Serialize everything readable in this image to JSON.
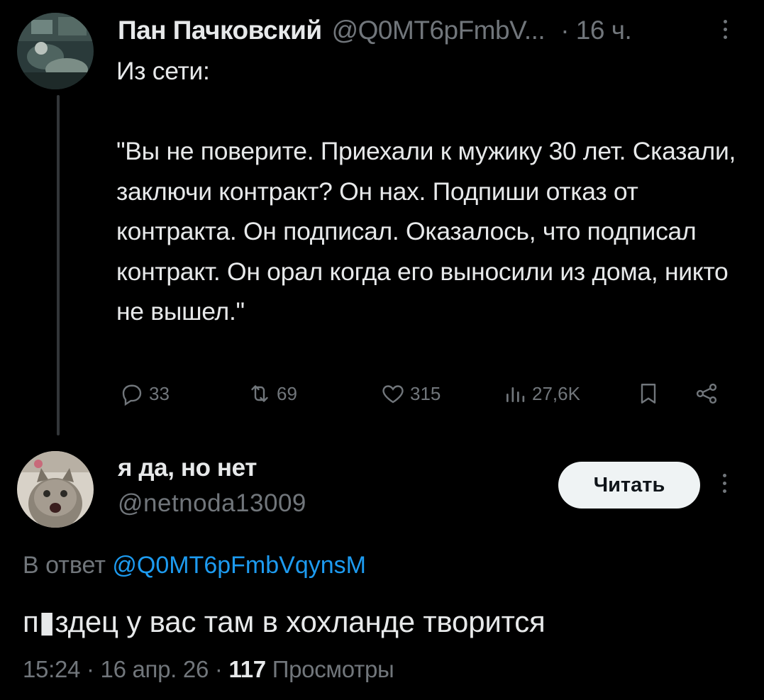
{
  "parent": {
    "author_name": "Пан Пачковский",
    "author_handle": "@Q0MT6pFmbV...",
    "time": "· 16 ч.",
    "text": "Из сети:\n\n\"Вы не поверите. Приехали к мужику 30 лет. Сказали, заключи контракт? Он нах. Подпиши отказ от контракта. Он подписал. Оказалось, что подписал контракт. Он орал когда его выносили из дома, никто не вышел.\"",
    "actions": {
      "replies": "33",
      "reposts": "69",
      "likes": "315",
      "views": "27,6K"
    }
  },
  "reply": {
    "author_name": "я да, но нет",
    "author_handle": "@netnoda13009",
    "follow_label": "Читать",
    "reply_prefix": "В ответ",
    "reply_to_handle": "@Q0MT6pFmbVqynsM",
    "text": "п▮здец у вас там в хохланде творится",
    "time": "15:24",
    "date": "16 апр. 26",
    "views_count": "117",
    "views_label": "Просмотры"
  },
  "colors": {
    "background": "#000000",
    "text": "#e7e9ea",
    "muted": "#71767b",
    "link": "#1d9bf0",
    "button_bg": "#eff3f4"
  },
  "icons": {
    "reply": "reply-icon",
    "repost": "repost-icon",
    "like": "heart-icon",
    "views": "views-icon",
    "bookmark": "bookmark-icon",
    "share": "share-icon",
    "more": "more-icon"
  }
}
